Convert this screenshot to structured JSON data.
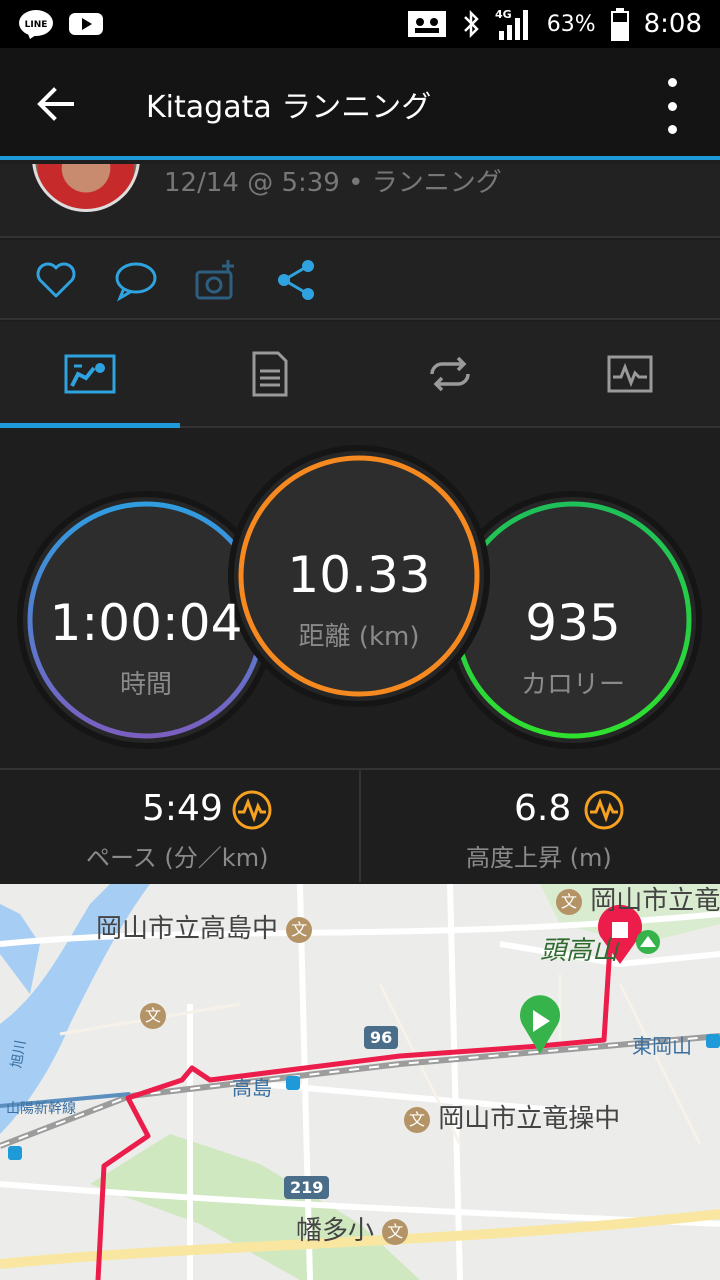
{
  "status_bar": {
    "battery": "63%",
    "time": "8:08",
    "network": "4G"
  },
  "app_bar": {
    "title": "Kitagata ランニング"
  },
  "activity": {
    "subtitle": "12/14 @ 5:39 • ランニング"
  },
  "rings": {
    "time_value": "1:00:04",
    "time_label": "時間",
    "distance_value": "10.33",
    "distance_label": "距離 (km)",
    "calories_value": "935",
    "calories_label": "カロリー"
  },
  "stats": {
    "pace_value": "5:49",
    "pace_label": "ペース (分／km)",
    "elevation_value": "6.8",
    "elevation_label": "高度上昇 (m)"
  },
  "map": {
    "labels": {
      "school1": "岡山市立高島中",
      "school2": "岡山市立竜操中",
      "school3": "幡多小",
      "school_top": "岡山市立竜",
      "park": "頭高山",
      "station1": "高島",
      "station2": "東岡山",
      "rail": "山陽新幹線",
      "river": "旭川"
    },
    "road_badges": {
      "r96": "96",
      "r219": "219"
    }
  },
  "colors": {
    "accent": "#1f9ad8",
    "time_ring_start": "#2f9de0",
    "time_ring_end": "#7b5fc0",
    "distance_ring": "#f6891f",
    "calories_ring": "#27d46a",
    "route": "#ec1c4b"
  }
}
